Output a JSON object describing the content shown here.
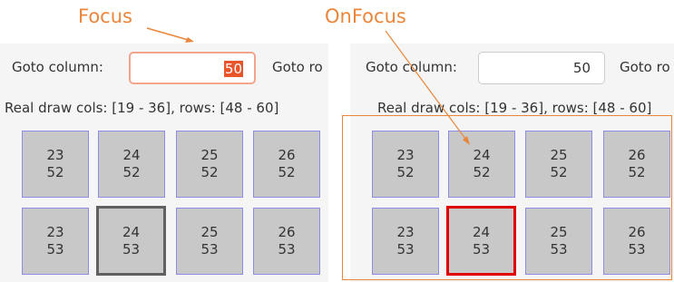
{
  "annotations": {
    "focus_label": "Focus",
    "onfocus_label": "OnFocus",
    "color": "#e9863b"
  },
  "focus_state": {
    "goto_label": "Goto column:",
    "goto_value": "50",
    "goto_row_label": "Goto ro",
    "real_draw": "Real draw cols: [19 - 36], rows: [48 - 60]",
    "rows": [
      {
        "cells": [
          {
            "col": "23",
            "row": "52"
          },
          {
            "col": "24",
            "row": "52"
          },
          {
            "col": "25",
            "row": "52"
          },
          {
            "col": "26",
            "row": "52"
          }
        ]
      },
      {
        "cells": [
          {
            "col": "23",
            "row": "53"
          },
          {
            "col": "24",
            "row": "53"
          },
          {
            "col": "25",
            "row": "53"
          },
          {
            "col": "26",
            "row": "53"
          }
        ]
      }
    ]
  },
  "onfocus_state": {
    "goto_label": "Goto column:",
    "goto_value": "50",
    "goto_row_label": "Goto ro",
    "real_draw": "Real draw cols: [19 - 36], rows: [48 - 60]",
    "rows": [
      {
        "cells": [
          {
            "col": "23",
            "row": "52"
          },
          {
            "col": "24",
            "row": "52"
          },
          {
            "col": "25",
            "row": "52"
          },
          {
            "col": "26",
            "row": "52"
          }
        ]
      },
      {
        "cells": [
          {
            "col": "23",
            "row": "53"
          },
          {
            "col": "24",
            "row": "53"
          },
          {
            "col": "25",
            "row": "53"
          },
          {
            "col": "26",
            "row": "53"
          }
        ]
      }
    ]
  },
  "colors": {
    "focus_border": "#606060",
    "onfocus_border": "#e00000",
    "cell_border": "#8d8ce8",
    "cell_fill": "#c8c8c8",
    "selection_highlight": "#e9552a"
  }
}
